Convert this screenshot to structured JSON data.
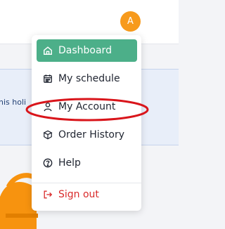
{
  "header": {
    "avatar_initial": "A"
  },
  "notice": {
    "text_fragment": "his holi"
  },
  "colors": {
    "accent": "#4caf89",
    "avatar": "#f79a1c",
    "signout": "#d92b2b",
    "annotation": "#d9151b"
  },
  "menu": {
    "items": [
      {
        "label": "Dashboard",
        "icon": "home-icon",
        "active": true
      },
      {
        "label": "My schedule",
        "icon": "calendar-icon"
      },
      {
        "label": "My Account",
        "icon": "user-icon"
      },
      {
        "label": "Order History",
        "icon": "box-icon"
      },
      {
        "label": "Help",
        "icon": "help-circle-icon"
      }
    ],
    "signout": {
      "label": "Sign out",
      "icon": "sign-out-icon"
    }
  }
}
